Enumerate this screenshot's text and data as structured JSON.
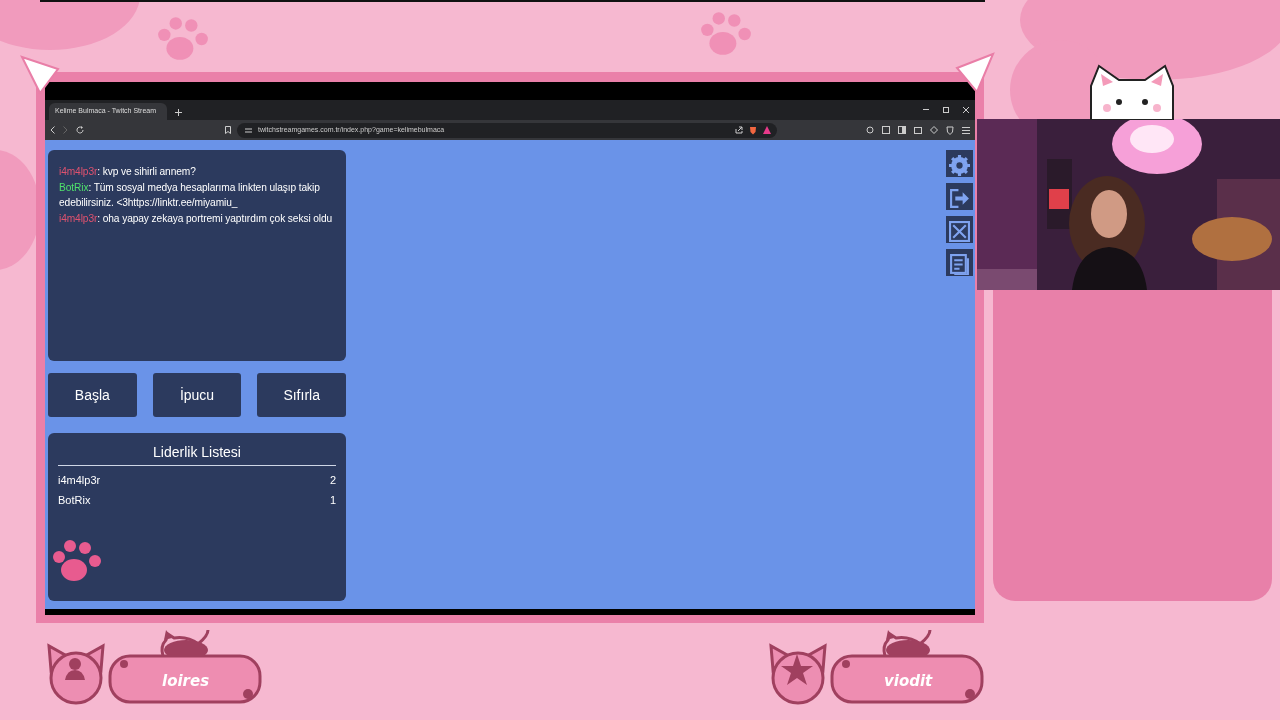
{
  "browser": {
    "tab_title": "Kelime Bulmaca - Twitch Stream",
    "url": "twitchstreamgames.com.tr/index.php?game=kelimebulmaca"
  },
  "chat": {
    "messages": [
      {
        "user": "i4m4lp3r",
        "color": "#e0526f",
        "text": ": kvp ve sihirli annem?"
      },
      {
        "user": "BotRix",
        "color": "#4fe06c",
        "text": ": Tüm sosyal medya hesaplarıma linkten ulaşıp takip edebilirsiniz. <3https://linktr.ee/miyamiu_"
      },
      {
        "user": "i4m4lp3r",
        "color": "#e0526f",
        "text": ": oha yapay zekaya portremi yaptırdım çok seksi oldu"
      }
    ]
  },
  "buttons": [
    "Başla",
    "İpucu",
    "Sıfırla"
  ],
  "leaderboard": {
    "title": "Liderlik Listesi",
    "rows": [
      {
        "name": "i4m4lp3r",
        "score": "2"
      },
      {
        "name": "BotRix",
        "score": "1"
      }
    ]
  },
  "side_tools": [
    {
      "kind": "settings"
    },
    {
      "kind": "exit"
    },
    {
      "kind": "fullscreen"
    },
    {
      "kind": "notes"
    }
  ],
  "webcam": {
    "kind": "picture"
  },
  "overlay_badges": [
    {
      "name": "loires",
      "kind": "user"
    },
    {
      "name": "viodit",
      "kind": "star"
    }
  ]
}
